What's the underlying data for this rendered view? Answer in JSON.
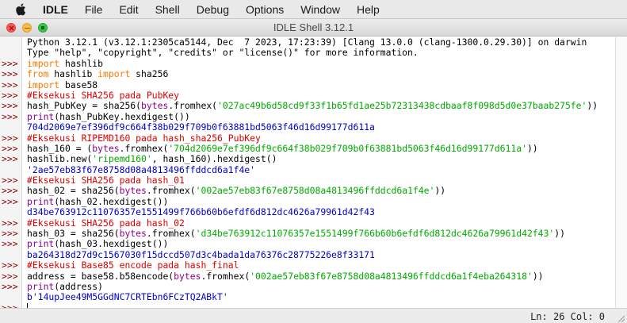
{
  "menubar": {
    "items": [
      {
        "label": "IDLE",
        "name": "menu-idle"
      },
      {
        "label": "File",
        "name": "menu-file"
      },
      {
        "label": "Edit",
        "name": "menu-edit"
      },
      {
        "label": "Shell",
        "name": "menu-shell"
      },
      {
        "label": "Debug",
        "name": "menu-debug"
      },
      {
        "label": "Options",
        "name": "menu-options"
      },
      {
        "label": "Window",
        "name": "menu-window"
      },
      {
        "label": "Help",
        "name": "menu-help"
      }
    ]
  },
  "window": {
    "title": "IDLE Shell 3.12.1"
  },
  "shell": {
    "lines": [
      {
        "prompt": "",
        "segments": [
          {
            "t": "Python 3.12.1 (v3.12.1:2305ca5144, Dec  7 2023, 17:23:39) [Clang 13.0.0 (clang-1300.0.29.30)] on darwin",
            "c": "plain"
          }
        ]
      },
      {
        "prompt": "",
        "segments": [
          {
            "t": "Type \"help\", \"copyright\", \"credits\" or \"license()\" for more information.",
            "c": "plain"
          }
        ]
      },
      {
        "prompt": ">>>",
        "segments": [
          {
            "t": "import",
            "c": "kw"
          },
          {
            "t": " hashlib",
            "c": "plain"
          }
        ]
      },
      {
        "prompt": ">>>",
        "segments": [
          {
            "t": "from",
            "c": "kw"
          },
          {
            "t": " hashlib ",
            "c": "plain"
          },
          {
            "t": "import",
            "c": "kw"
          },
          {
            "t": " sha256",
            "c": "plain"
          }
        ]
      },
      {
        "prompt": ">>>",
        "segments": [
          {
            "t": "import",
            "c": "kw"
          },
          {
            "t": " base58",
            "c": "plain"
          }
        ]
      },
      {
        "prompt": ">>>",
        "segments": [
          {
            "t": "#Eksekusi SHA256 pada PubKey",
            "c": "cmt"
          }
        ]
      },
      {
        "prompt": ">>>",
        "segments": [
          {
            "t": "hash_PubKey = sha256(",
            "c": "plain"
          },
          {
            "t": "bytes",
            "c": "bi"
          },
          {
            "t": ".fromhex(",
            "c": "plain"
          },
          {
            "t": "'027ac49b6d58cd9f33f1b65fd1ae25b72313438cdbaaf8f098d5d0e37baab275fe'",
            "c": "str"
          },
          {
            "t": "))",
            "c": "plain"
          }
        ]
      },
      {
        "prompt": ">>>",
        "segments": [
          {
            "t": "print",
            "c": "bi"
          },
          {
            "t": "(hash_PubKey.hexdigest())",
            "c": "plain"
          }
        ]
      },
      {
        "prompt": "",
        "segments": [
          {
            "t": "704d2069e7ef396df9c664f38b029f709b0f63881bd5063f46d16d99177d611a",
            "c": "out"
          }
        ]
      },
      {
        "prompt": ">>>",
        "segments": [
          {
            "t": "#Eksekusi RIPEMD160 pada hash_sha256_PubKey",
            "c": "cmt"
          }
        ]
      },
      {
        "prompt": ">>>",
        "segments": [
          {
            "t": "hash_160 = (",
            "c": "plain"
          },
          {
            "t": "bytes",
            "c": "bi"
          },
          {
            "t": ".fromhex(",
            "c": "plain"
          },
          {
            "t": "'704d2069e7ef396df9c664f38b029f709b0f63881bd5063f46d16d99177d611a'",
            "c": "str"
          },
          {
            "t": "))",
            "c": "plain"
          }
        ]
      },
      {
        "prompt": ">>>",
        "segments": [
          {
            "t": "hashlib.new(",
            "c": "plain"
          },
          {
            "t": "'ripemd160'",
            "c": "str"
          },
          {
            "t": ", hash_160).hexdigest()",
            "c": "plain"
          }
        ]
      },
      {
        "prompt": "",
        "segments": [
          {
            "t": "'2ae57eb83f67e8758d08a4813496ffddcd6a1f4e'",
            "c": "out"
          }
        ]
      },
      {
        "prompt": ">>>",
        "segments": [
          {
            "t": "#Eksekusi SHA256 pada hash_01",
            "c": "cmt"
          }
        ]
      },
      {
        "prompt": ">>>",
        "segments": [
          {
            "t": "hash_02 = sha256(",
            "c": "plain"
          },
          {
            "t": "bytes",
            "c": "bi"
          },
          {
            "t": ".fromhex(",
            "c": "plain"
          },
          {
            "t": "'002ae57eb83f67e8758d08a4813496ffddcd6a1f4e'",
            "c": "str"
          },
          {
            "t": "))",
            "c": "plain"
          }
        ]
      },
      {
        "prompt": ">>>",
        "segments": [
          {
            "t": "print",
            "c": "bi"
          },
          {
            "t": "(hash_02.hexdigest())",
            "c": "plain"
          }
        ]
      },
      {
        "prompt": "",
        "segments": [
          {
            "t": "d34be763912c11076357e1551499f766b60b6efdf6d812dc4626a79961d42f43",
            "c": "out"
          }
        ]
      },
      {
        "prompt": ">>>",
        "segments": [
          {
            "t": "#Eksekusi SHA256 pada hash_02",
            "c": "cmt"
          }
        ]
      },
      {
        "prompt": ">>>",
        "segments": [
          {
            "t": "hash_03 = sha256(",
            "c": "plain"
          },
          {
            "t": "bytes",
            "c": "bi"
          },
          {
            "t": ".fromhex(",
            "c": "plain"
          },
          {
            "t": "'d34be763912c11076357e1551499f766b60b6efdf6d812dc4626a79961d42f43'",
            "c": "str"
          },
          {
            "t": "))",
            "c": "plain"
          }
        ]
      },
      {
        "prompt": ">>>",
        "segments": [
          {
            "t": "print",
            "c": "bi"
          },
          {
            "t": "(hash_03.hexdigest())",
            "c": "plain"
          }
        ]
      },
      {
        "prompt": "",
        "segments": [
          {
            "t": "ba264318d27d9c1567030f15dccd507d3c4bada1da76376c28775226e8f33171",
            "c": "out"
          }
        ]
      },
      {
        "prompt": ">>>",
        "segments": [
          {
            "t": "#Eksekusi Base85 encode pada hash_final",
            "c": "cmt"
          }
        ]
      },
      {
        "prompt": ">>>",
        "segments": [
          {
            "t": "address = base58.b58encode(",
            "c": "plain"
          },
          {
            "t": "bytes",
            "c": "bi"
          },
          {
            "t": ".fromhex(",
            "c": "plain"
          },
          {
            "t": "'002ae57eb83f67e8758d08a4813496ffddcd6a1f4eba264318'",
            "c": "str"
          },
          {
            "t": "))",
            "c": "plain"
          }
        ]
      },
      {
        "prompt": ">>>",
        "segments": [
          {
            "t": "print",
            "c": "bi"
          },
          {
            "t": "(address)",
            "c": "plain"
          }
        ]
      },
      {
        "prompt": "",
        "segments": [
          {
            "t": "b'14upJee49M5GGdNC7CRTEbn6FCzTQ2ABkT'",
            "c": "out"
          }
        ]
      },
      {
        "prompt": ">>>",
        "segments": [],
        "cursor": true
      }
    ]
  },
  "status": {
    "position": "Ln: 26  Col: 0"
  },
  "colors": {
    "keyword": "#ff7700",
    "builtin": "#900090",
    "string": "#00aa00",
    "comment": "#dd0000",
    "output": "#0000cc",
    "prompt": "#8b0000"
  },
  "icons": {
    "apple": "apple-logo-icon",
    "close": "close-window-icon",
    "minimize": "minimize-window-icon",
    "maximize": "fullscreen-window-icon"
  }
}
